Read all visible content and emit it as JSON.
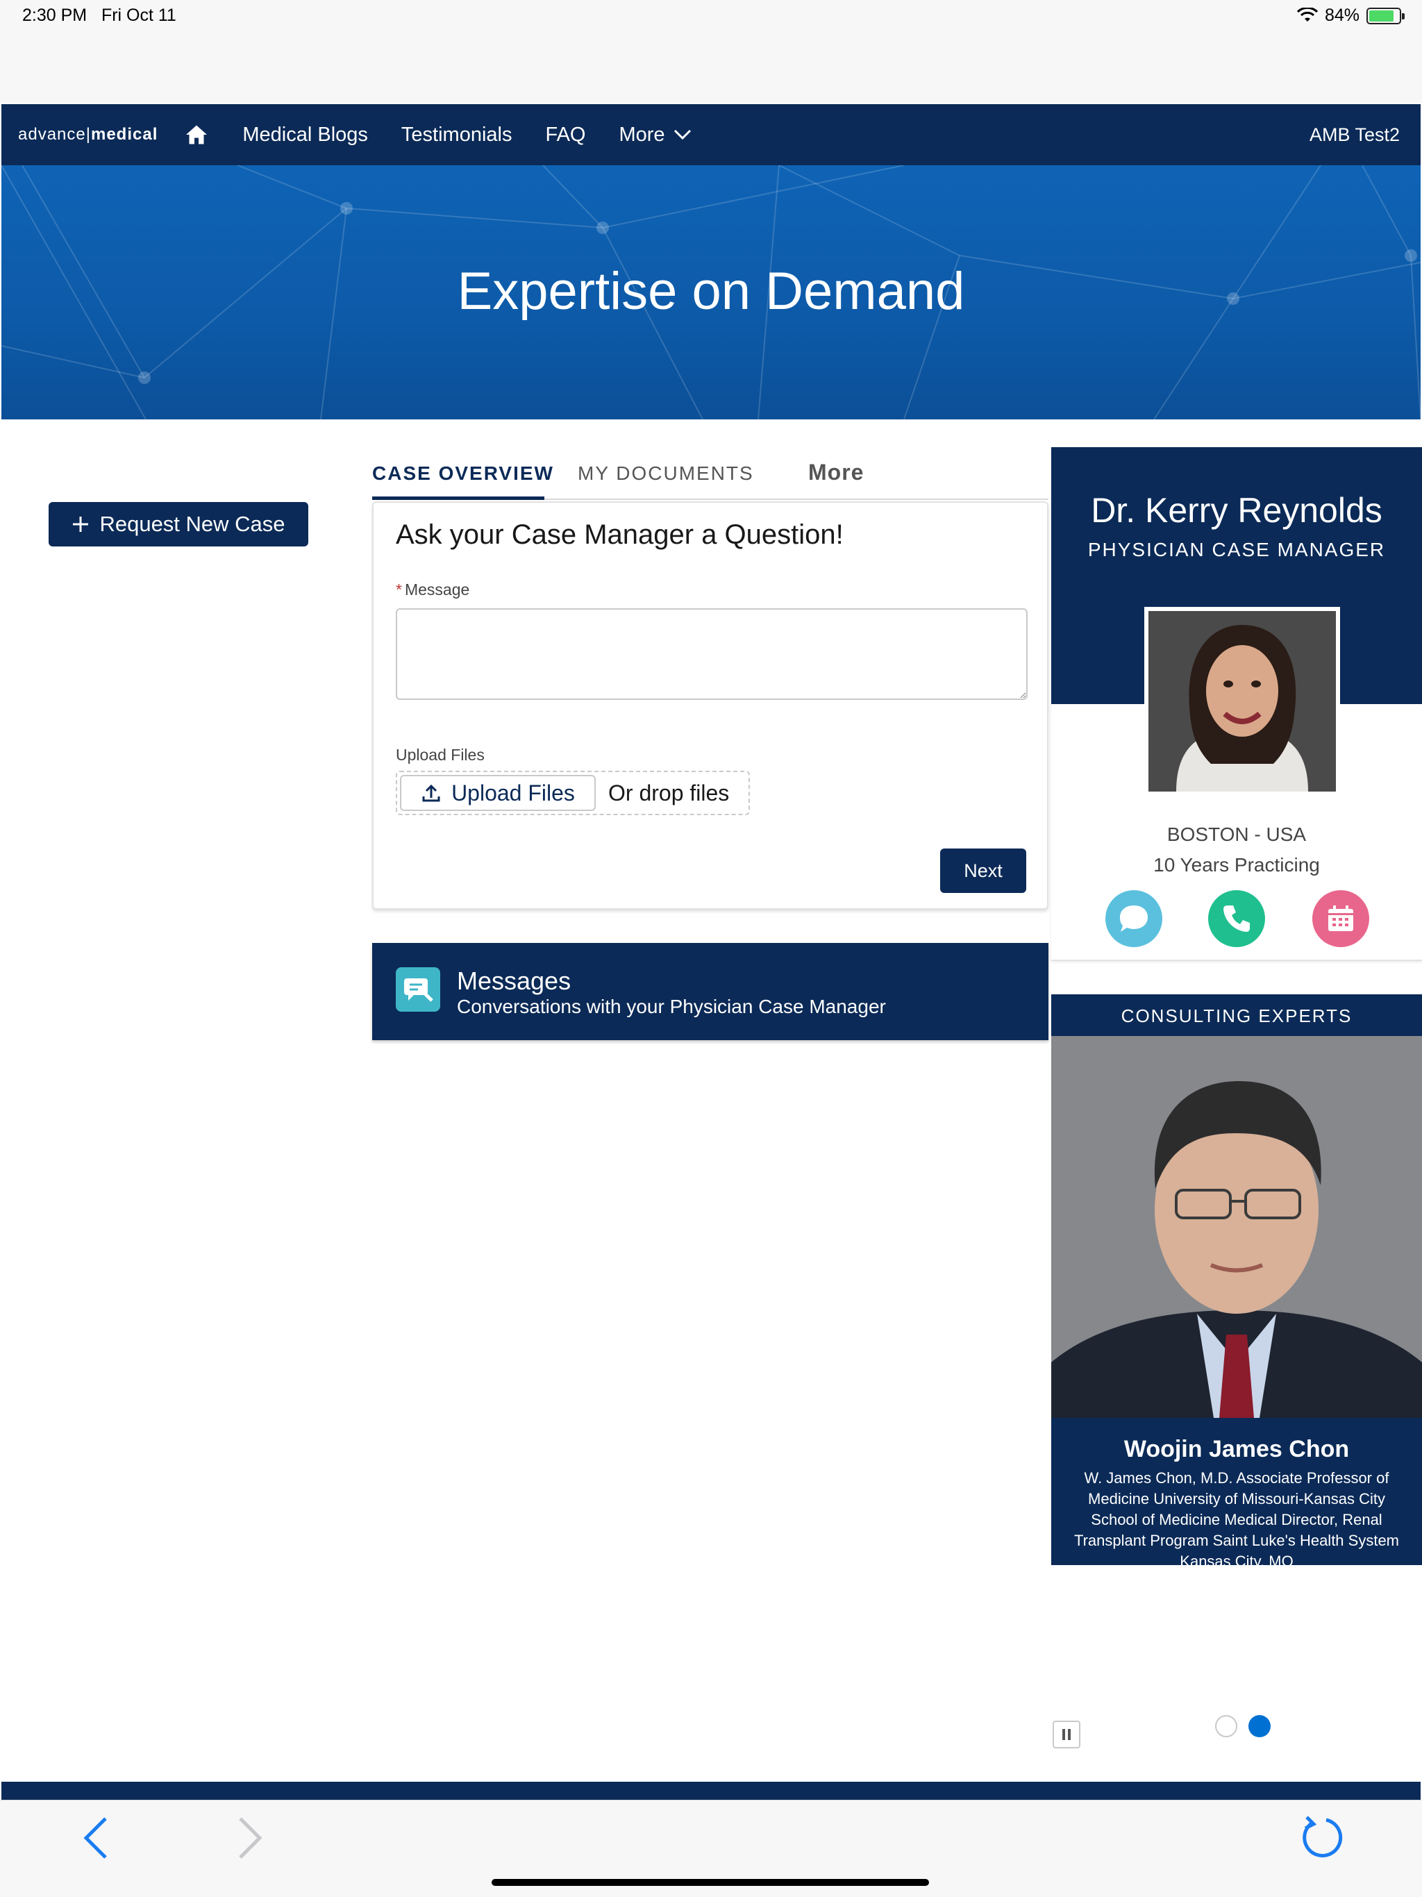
{
  "status_bar": {
    "time": "2:30 PM",
    "date": "Fri Oct 11",
    "battery": "84%",
    "battery_level": 0.84
  },
  "nav": {
    "logo_left": "advance",
    "logo_sep": "|",
    "logo_right": "medical",
    "home_icon": "home-icon",
    "links": [
      "Medical Blogs",
      "Testimonials",
      "FAQ"
    ],
    "more": "More",
    "user": "AMB Test2"
  },
  "hero": {
    "title": "Expertise on Demand"
  },
  "request_button": {
    "label": "Request New Case"
  },
  "tabs": {
    "overview": "CASE OVERVIEW",
    "documents": "MY DOCUMENTS",
    "more": "More"
  },
  "form": {
    "title": "Ask your Case Manager a Question!",
    "required_mark": "*",
    "message_label": "Message",
    "message_value": "",
    "upload_label": "Upload Files",
    "upload_button": "Upload Files",
    "drop_text": "Or drop files",
    "next_button": "Next"
  },
  "messages": {
    "title": "Messages",
    "subtitle": "Conversations with your Physician Case Manager"
  },
  "case_manager": {
    "name": "Dr. Kerry Reynolds",
    "role": "PHYSICIAN CASE MANAGER",
    "location": "BOSTON - USA",
    "experience": "10 Years Practicing",
    "actions": [
      "chat-icon",
      "phone-icon",
      "calendar-icon"
    ],
    "colors": {
      "chat": "#5bc0de",
      "phone": "#1fbf8f",
      "calendar": "#e8668b"
    }
  },
  "experts": {
    "title": "CONSULTING EXPERTS",
    "name": "Woojin James Chon",
    "bio": "W. James Chon, M.D. Associate Professor of Medicine  University of Missouri-Kansas City School of Medicine Medical Director, Renal Transplant Program  Saint Luke's Health System Kansas City, MO"
  },
  "colors": {
    "brand": "#0b2a57",
    "hero": "#0d5aa8",
    "accent": "#0070d2"
  }
}
